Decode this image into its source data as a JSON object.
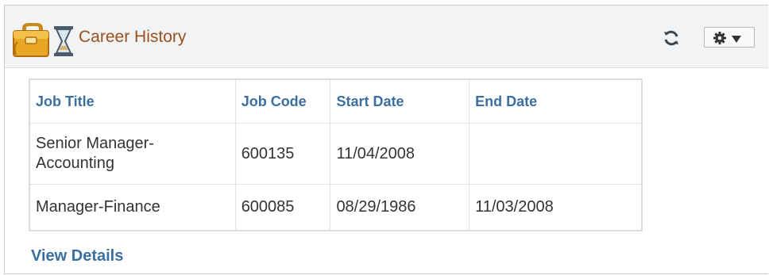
{
  "pagelet": {
    "title": "Career History",
    "header_icon": "briefcase-hourglass-icon",
    "refresh_icon": "refresh-icon",
    "menu_icon": "gear-icon",
    "title_color": "#9c4f1c",
    "link_color": "#3b6fa0"
  },
  "table": {
    "headers": [
      "Job Title",
      "Job Code",
      "Start Date",
      "End Date"
    ],
    "rows": [
      {
        "job_title_line1": "Senior Manager-",
        "job_title_line2": "Accounting",
        "job_code": "600135",
        "start_date": "11/04/2008",
        "end_date": ""
      },
      {
        "job_title": "Manager-Finance",
        "job_code": "600085",
        "start_date": "08/29/1986",
        "end_date": "11/03/2008"
      }
    ]
  },
  "footer": {
    "view_details": "View Details"
  }
}
